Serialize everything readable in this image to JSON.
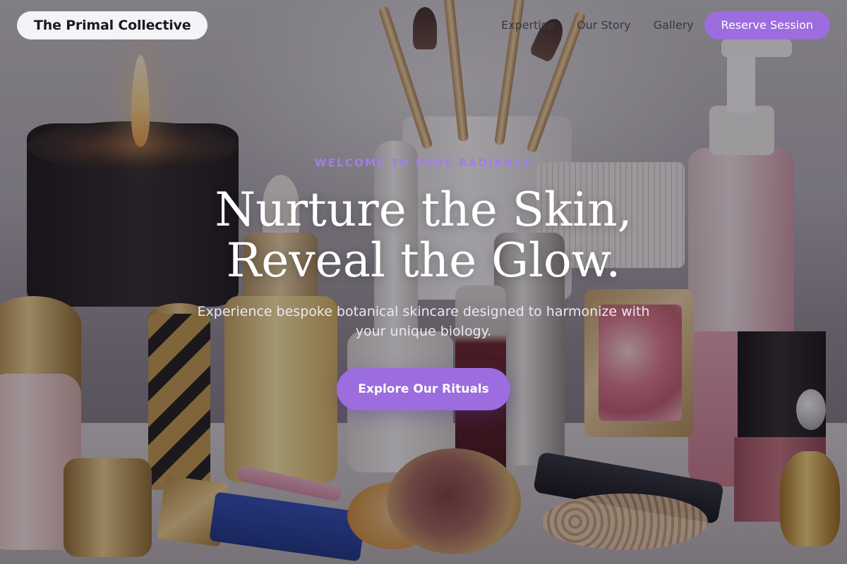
{
  "nav": {
    "brand": "The Primal Collective",
    "links": [
      "Expertise",
      "Our Story",
      "Gallery"
    ],
    "cta": "Reserve Session"
  },
  "hero": {
    "eyebrow": "WELCOME TO PURE RADIANCE",
    "headline_line1": "Nurture the Skin,",
    "headline_line2": "Reveal the Glow.",
    "subtitle": "Experience bespoke botanical skincare designed to harmonize with your unique biology.",
    "cta": "Explore Our Rituals"
  },
  "colors": {
    "accent": "#9b6dde",
    "eyebrow": "#a07ee8",
    "brand_pill": "#f4f3f6"
  }
}
